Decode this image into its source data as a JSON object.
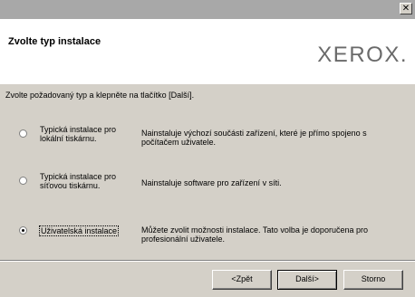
{
  "window": {
    "close_glyph": "✕"
  },
  "header": {
    "title": "Zvolte typ instalace",
    "logo": "XEROX",
    "logo_dot": "."
  },
  "instruction": "Zvolte požadovaný typ a klepněte na tlačítko [Další].",
  "options": [
    {
      "label_line1": "Typická instalace pro",
      "label_line2": "lokální tiskárnu.",
      "desc_line1": "Nainstaluje výchozí součásti zařízení, které je přímo spojeno s",
      "desc_line2": "počítačem uživatele.",
      "selected": false
    },
    {
      "label_line1": "Typická instalace pro",
      "label_line2": "síťovou tiskárnu.",
      "desc_line1": "Nainstaluje software pro zařízení v síti.",
      "desc_line2": "",
      "selected": false
    },
    {
      "label_line1": "Uživatelská instalace",
      "label_line2": "",
      "desc_line1": "Můžete zvolit možnosti instalace. Tato volba je doporučena pro",
      "desc_line2": "profesionální uživatele.",
      "selected": true
    }
  ],
  "buttons": {
    "back": "<Zpět",
    "next": "Další>",
    "cancel": "Storno"
  }
}
